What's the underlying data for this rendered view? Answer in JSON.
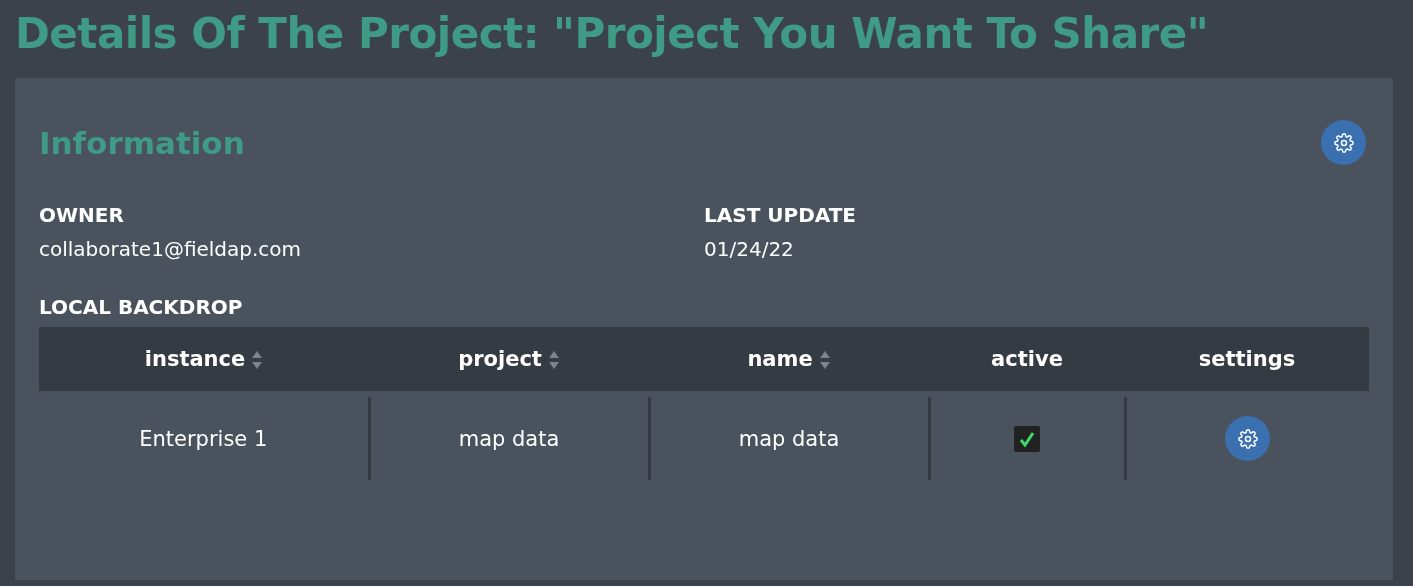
{
  "page": {
    "title": "Details Of The Project: \"Project You Want To Share\""
  },
  "information": {
    "title": "Information",
    "fields": [
      {
        "label": "OWNER",
        "value": "collaborate1@fieldap.com"
      },
      {
        "label": "LAST UPDATE",
        "value": "01/24/22"
      }
    ]
  },
  "local_backdrop": {
    "title": "LOCAL BACKDROP",
    "columns": [
      {
        "label": "instance",
        "sortable": true
      },
      {
        "label": "project",
        "sortable": true
      },
      {
        "label": "name",
        "sortable": true
      },
      {
        "label": "active",
        "sortable": false
      },
      {
        "label": "settings",
        "sortable": false
      }
    ],
    "rows": [
      {
        "instance": "Enterprise 1",
        "project": "map data",
        "name": "map data",
        "active": true
      }
    ]
  }
}
